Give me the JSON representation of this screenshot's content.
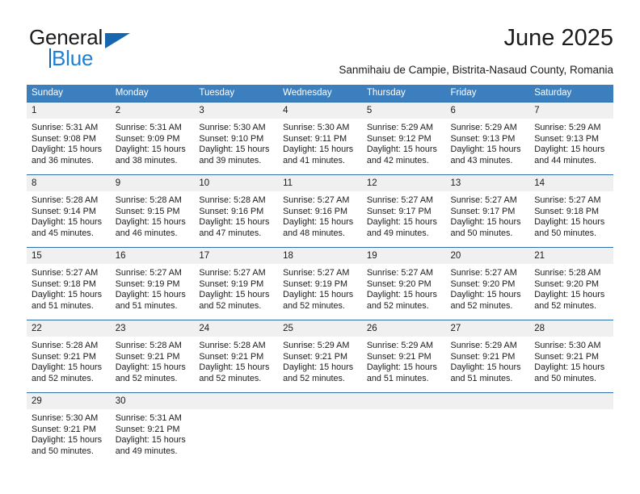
{
  "logo": {
    "word_one": "General",
    "word_two": "Blue",
    "triangle_color": "#1667b0",
    "blue_text_color": "#1f7fd4"
  },
  "header": {
    "title": "June 2025",
    "subtitle": "Sanmihaiu de Campie, Bistrita-Nasaud County, Romania",
    "header_bg_color": "#3c7fbe",
    "row_border_color": "#2e6ead",
    "daynum_bg_color": "#f0f0f0"
  },
  "calendar": {
    "weekday_headers": [
      "Sunday",
      "Monday",
      "Tuesday",
      "Wednesday",
      "Thursday",
      "Friday",
      "Saturday"
    ],
    "weeks": [
      [
        {
          "day": "1",
          "sunrise": "Sunrise: 5:31 AM",
          "sunset": "Sunset: 9:08 PM",
          "daylight_1": "Daylight: 15 hours",
          "daylight_2": "and 36 minutes."
        },
        {
          "day": "2",
          "sunrise": "Sunrise: 5:31 AM",
          "sunset": "Sunset: 9:09 PM",
          "daylight_1": "Daylight: 15 hours",
          "daylight_2": "and 38 minutes."
        },
        {
          "day": "3",
          "sunrise": "Sunrise: 5:30 AM",
          "sunset": "Sunset: 9:10 PM",
          "daylight_1": "Daylight: 15 hours",
          "daylight_2": "and 39 minutes."
        },
        {
          "day": "4",
          "sunrise": "Sunrise: 5:30 AM",
          "sunset": "Sunset: 9:11 PM",
          "daylight_1": "Daylight: 15 hours",
          "daylight_2": "and 41 minutes."
        },
        {
          "day": "5",
          "sunrise": "Sunrise: 5:29 AM",
          "sunset": "Sunset: 9:12 PM",
          "daylight_1": "Daylight: 15 hours",
          "daylight_2": "and 42 minutes."
        },
        {
          "day": "6",
          "sunrise": "Sunrise: 5:29 AM",
          "sunset": "Sunset: 9:13 PM",
          "daylight_1": "Daylight: 15 hours",
          "daylight_2": "and 43 minutes."
        },
        {
          "day": "7",
          "sunrise": "Sunrise: 5:29 AM",
          "sunset": "Sunset: 9:13 PM",
          "daylight_1": "Daylight: 15 hours",
          "daylight_2": "and 44 minutes."
        }
      ],
      [
        {
          "day": "8",
          "sunrise": "Sunrise: 5:28 AM",
          "sunset": "Sunset: 9:14 PM",
          "daylight_1": "Daylight: 15 hours",
          "daylight_2": "and 45 minutes."
        },
        {
          "day": "9",
          "sunrise": "Sunrise: 5:28 AM",
          "sunset": "Sunset: 9:15 PM",
          "daylight_1": "Daylight: 15 hours",
          "daylight_2": "and 46 minutes."
        },
        {
          "day": "10",
          "sunrise": "Sunrise: 5:28 AM",
          "sunset": "Sunset: 9:16 PM",
          "daylight_1": "Daylight: 15 hours",
          "daylight_2": "and 47 minutes."
        },
        {
          "day": "11",
          "sunrise": "Sunrise: 5:27 AM",
          "sunset": "Sunset: 9:16 PM",
          "daylight_1": "Daylight: 15 hours",
          "daylight_2": "and 48 minutes."
        },
        {
          "day": "12",
          "sunrise": "Sunrise: 5:27 AM",
          "sunset": "Sunset: 9:17 PM",
          "daylight_1": "Daylight: 15 hours",
          "daylight_2": "and 49 minutes."
        },
        {
          "day": "13",
          "sunrise": "Sunrise: 5:27 AM",
          "sunset": "Sunset: 9:17 PM",
          "daylight_1": "Daylight: 15 hours",
          "daylight_2": "and 50 minutes."
        },
        {
          "day": "14",
          "sunrise": "Sunrise: 5:27 AM",
          "sunset": "Sunset: 9:18 PM",
          "daylight_1": "Daylight: 15 hours",
          "daylight_2": "and 50 minutes."
        }
      ],
      [
        {
          "day": "15",
          "sunrise": "Sunrise: 5:27 AM",
          "sunset": "Sunset: 9:18 PM",
          "daylight_1": "Daylight: 15 hours",
          "daylight_2": "and 51 minutes."
        },
        {
          "day": "16",
          "sunrise": "Sunrise: 5:27 AM",
          "sunset": "Sunset: 9:19 PM",
          "daylight_1": "Daylight: 15 hours",
          "daylight_2": "and 51 minutes."
        },
        {
          "day": "17",
          "sunrise": "Sunrise: 5:27 AM",
          "sunset": "Sunset: 9:19 PM",
          "daylight_1": "Daylight: 15 hours",
          "daylight_2": "and 52 minutes."
        },
        {
          "day": "18",
          "sunrise": "Sunrise: 5:27 AM",
          "sunset": "Sunset: 9:19 PM",
          "daylight_1": "Daylight: 15 hours",
          "daylight_2": "and 52 minutes."
        },
        {
          "day": "19",
          "sunrise": "Sunrise: 5:27 AM",
          "sunset": "Sunset: 9:20 PM",
          "daylight_1": "Daylight: 15 hours",
          "daylight_2": "and 52 minutes."
        },
        {
          "day": "20",
          "sunrise": "Sunrise: 5:27 AM",
          "sunset": "Sunset: 9:20 PM",
          "daylight_1": "Daylight: 15 hours",
          "daylight_2": "and 52 minutes."
        },
        {
          "day": "21",
          "sunrise": "Sunrise: 5:28 AM",
          "sunset": "Sunset: 9:20 PM",
          "daylight_1": "Daylight: 15 hours",
          "daylight_2": "and 52 minutes."
        }
      ],
      [
        {
          "day": "22",
          "sunrise": "Sunrise: 5:28 AM",
          "sunset": "Sunset: 9:21 PM",
          "daylight_1": "Daylight: 15 hours",
          "daylight_2": "and 52 minutes."
        },
        {
          "day": "23",
          "sunrise": "Sunrise: 5:28 AM",
          "sunset": "Sunset: 9:21 PM",
          "daylight_1": "Daylight: 15 hours",
          "daylight_2": "and 52 minutes."
        },
        {
          "day": "24",
          "sunrise": "Sunrise: 5:28 AM",
          "sunset": "Sunset: 9:21 PM",
          "daylight_1": "Daylight: 15 hours",
          "daylight_2": "and 52 minutes."
        },
        {
          "day": "25",
          "sunrise": "Sunrise: 5:29 AM",
          "sunset": "Sunset: 9:21 PM",
          "daylight_1": "Daylight: 15 hours",
          "daylight_2": "and 52 minutes."
        },
        {
          "day": "26",
          "sunrise": "Sunrise: 5:29 AM",
          "sunset": "Sunset: 9:21 PM",
          "daylight_1": "Daylight: 15 hours",
          "daylight_2": "and 51 minutes."
        },
        {
          "day": "27",
          "sunrise": "Sunrise: 5:29 AM",
          "sunset": "Sunset: 9:21 PM",
          "daylight_1": "Daylight: 15 hours",
          "daylight_2": "and 51 minutes."
        },
        {
          "day": "28",
          "sunrise": "Sunrise: 5:30 AM",
          "sunset": "Sunset: 9:21 PM",
          "daylight_1": "Daylight: 15 hours",
          "daylight_2": "and 50 minutes."
        }
      ],
      [
        {
          "day": "29",
          "sunrise": "Sunrise: 5:30 AM",
          "sunset": "Sunset: 9:21 PM",
          "daylight_1": "Daylight: 15 hours",
          "daylight_2": "and 50 minutes."
        },
        {
          "day": "30",
          "sunrise": "Sunrise: 5:31 AM",
          "sunset": "Sunset: 9:21 PM",
          "daylight_1": "Daylight: 15 hours",
          "daylight_2": "and 49 minutes."
        },
        {
          "day": "",
          "sunrise": "",
          "sunset": "",
          "daylight_1": "",
          "daylight_2": ""
        },
        {
          "day": "",
          "sunrise": "",
          "sunset": "",
          "daylight_1": "",
          "daylight_2": ""
        },
        {
          "day": "",
          "sunrise": "",
          "sunset": "",
          "daylight_1": "",
          "daylight_2": ""
        },
        {
          "day": "",
          "sunrise": "",
          "sunset": "",
          "daylight_1": "",
          "daylight_2": ""
        },
        {
          "day": "",
          "sunrise": "",
          "sunset": "",
          "daylight_1": "",
          "daylight_2": ""
        }
      ]
    ]
  }
}
